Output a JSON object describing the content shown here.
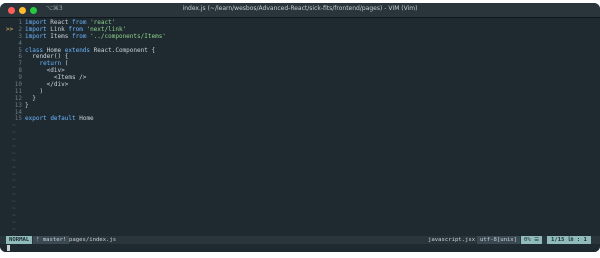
{
  "window": {
    "shortcut": "⌥⌘3",
    "title": "index.js (~/learn/wesbos/Advanced-React/sick-fits/frontend/pages) - VIM (Vim)"
  },
  "editor": {
    "sign_marker": ">>",
    "tilde": "~",
    "lines": [
      {
        "n": "1",
        "text": "import React from 'react'"
      },
      {
        "n": "2",
        "text": "import Link from 'next/link'"
      },
      {
        "n": "3",
        "text": "import Items from '../components/Items'"
      },
      {
        "n": "4",
        "text": ""
      },
      {
        "n": "5",
        "text": "class Home extends React.Component {"
      },
      {
        "n": "6",
        "text": "  render() {"
      },
      {
        "n": "7",
        "text": "    return ("
      },
      {
        "n": "8",
        "text": "      <div>"
      },
      {
        "n": "9",
        "text": "        <Items />"
      },
      {
        "n": "10",
        "text": "      </div>"
      },
      {
        "n": "11",
        "text": "    )"
      },
      {
        "n": "12",
        "text": "  }"
      },
      {
        "n": "13",
        "text": "}"
      },
      {
        "n": "14",
        "text": ""
      },
      {
        "n": "15",
        "text": "export default Home"
      }
    ]
  },
  "statusline": {
    "mode": "NORMAL",
    "branch": "ᚠ master!",
    "file": "pages/index.js",
    "filetype": "javascript.jsx",
    "encoding": "utf-8[unix]",
    "percent": "0% ☰",
    "position": "1/15 ㏑ : 1"
  },
  "colors": {
    "background": "#1f2a30",
    "keyword": "#6cb6ff",
    "string": "#8fd18a",
    "mode_bg": "#8fbcbb"
  }
}
